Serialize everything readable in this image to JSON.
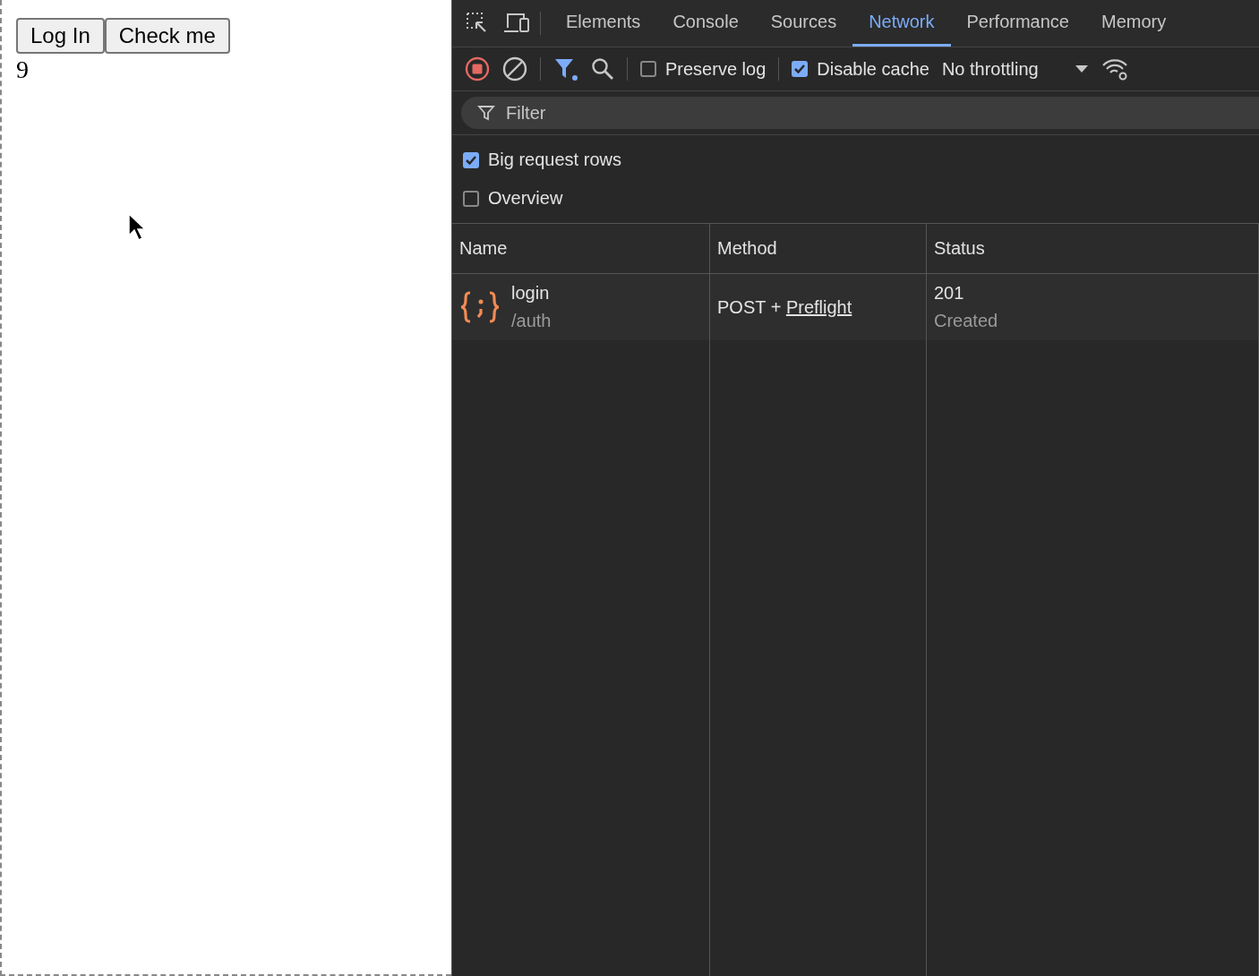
{
  "page": {
    "buttons": [
      "Log In",
      "Check me"
    ],
    "counter": "9"
  },
  "devtools": {
    "tabs": [
      {
        "label": "Elements",
        "selected": false
      },
      {
        "label": "Console",
        "selected": false
      },
      {
        "label": "Sources",
        "selected": false
      },
      {
        "label": "Network",
        "selected": true
      },
      {
        "label": "Performance",
        "selected": false
      },
      {
        "label": "Memory",
        "selected": false
      }
    ],
    "toolbar": {
      "recording": true,
      "preserve_log": {
        "label": "Preserve log",
        "checked": false
      },
      "disable_cache": {
        "label": "Disable cache",
        "checked": true
      },
      "throttling": "No throttling"
    },
    "filter": {
      "placeholder": "Filter"
    },
    "options": [
      {
        "label": "Big request rows",
        "checked": true
      },
      {
        "label": "Overview",
        "checked": false
      }
    ],
    "table": {
      "columns": [
        "Name",
        "Method",
        "Status"
      ],
      "rows": [
        {
          "name": "login",
          "path": "/auth",
          "method": "POST + ",
          "method_link": "Preflight",
          "status": "201",
          "status_text": "Created"
        }
      ]
    }
  }
}
